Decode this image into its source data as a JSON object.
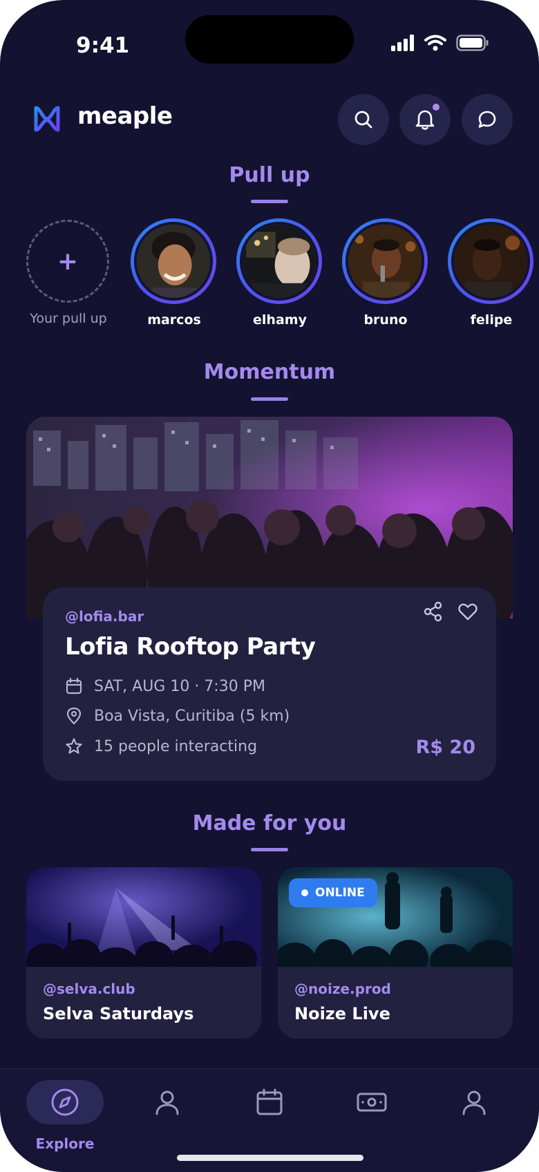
{
  "status_bar": {
    "time": "9:41"
  },
  "header": {
    "brand": "meaple"
  },
  "sections": {
    "pull_up": "Pull up",
    "momentum": "Momentum",
    "made_for_you": "Made for you"
  },
  "stories": {
    "own_label": "Your pull up",
    "add_symbol": "+",
    "users": [
      {
        "name": "marcos"
      },
      {
        "name": "elhamy"
      },
      {
        "name": "bruno"
      },
      {
        "name": "felipe"
      }
    ]
  },
  "featured_event": {
    "handle": "@lofia.bar",
    "title": "Lofia Rooftop Party",
    "date": "SAT, AUG 10 · 7:30 PM",
    "location": "Boa Vista, Curitiba (5 km)",
    "interacting": "15 people interacting",
    "price": "R$ 20"
  },
  "recommended": [
    {
      "handle": "@selva.club",
      "title": "Selva Saturdays"
    },
    {
      "handle": "@noize.prod",
      "title": "Noize Live",
      "badge": "ONLINE"
    }
  ],
  "tabbar": {
    "active_label": "Explore",
    "tabs": [
      "compass-icon",
      "person-icon",
      "calendar-icon",
      "ticket-icon",
      "profile-icon"
    ]
  },
  "colors": {
    "background": "#131230",
    "accent": "#a48aee",
    "card": "#22213f",
    "badge": "#2f7cf0"
  }
}
